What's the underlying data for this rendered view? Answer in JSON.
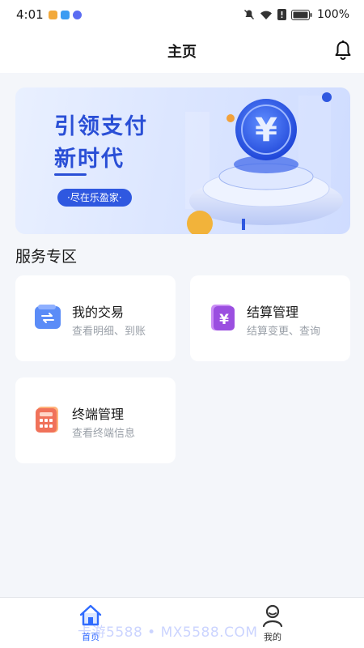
{
  "status_bar": {
    "time": "4:01",
    "battery": "100%"
  },
  "header": {
    "title": "主页"
  },
  "banner": {
    "slogan_line1": "引领支付",
    "slogan_line2": "新时代",
    "tagline": "·尽在乐盈家·"
  },
  "section": {
    "title": "服务专区"
  },
  "cards": [
    {
      "name": "我的交易",
      "desc": "查看明细、到账",
      "icon": "transaction-icon"
    },
    {
      "name": "结算管理",
      "desc": "结算变更、查询",
      "icon": "yen-settlement-icon"
    },
    {
      "name": "终端管理",
      "desc": "查看终端信息",
      "icon": "terminal-calculator-icon"
    }
  ],
  "tabbar": {
    "items": [
      {
        "label": "首页",
        "icon": "home-icon",
        "active": true
      },
      {
        "label": "我的",
        "icon": "profile-icon",
        "active": false
      }
    ]
  },
  "watermark": "卡游5588 • MX5588.COM",
  "colors": {
    "accent": "#2f6bff",
    "banner_text": "#2a4fd6",
    "tab_active": "#2f6bff",
    "tab_inactive": "#333333"
  }
}
